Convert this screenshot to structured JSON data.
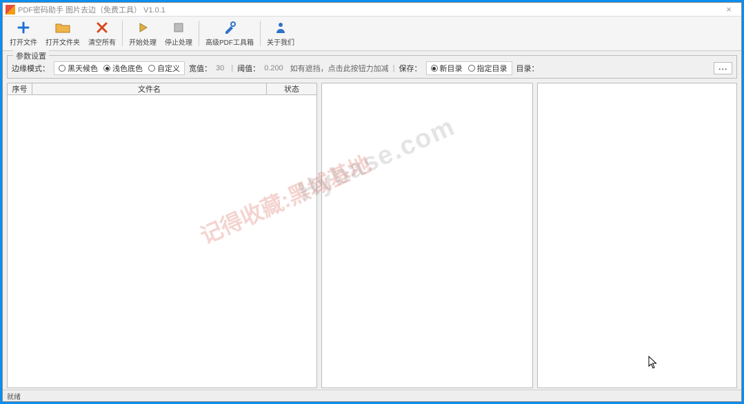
{
  "title": "PDF密码助手 图片去边（免费工具） V1.0.1",
  "toolbar": {
    "open_file": "打开文件",
    "open_files": "打开文件夹",
    "clear_all": "清空所有",
    "start": "开始处理",
    "stop": "停止处理",
    "advanced": "高级PDF工具箱",
    "about": "关于我们"
  },
  "options": {
    "legend": "参数设置",
    "edge_mode_label": "边缘模式：",
    "edge_modes": {
      "black": "黑天候色",
      "light": "浅色底色",
      "custom": "自定义"
    },
    "edge_selected": "light",
    "width_label": "宽值：",
    "width_value": "30",
    "ratio_label": "阈值：",
    "ratio_value": "0.200",
    "note": "如有遮挡，点击此按钮力加减",
    "save_label": "保存：",
    "save_modes": {
      "new": "新目录",
      "specify": "指定目录"
    },
    "save_selected": "new",
    "dir_label": "目录：",
    "dir_value": ""
  },
  "table": {
    "col_seq": "序号",
    "col_file": "文件名",
    "col_status": "状态"
  },
  "statusbar": "就绪",
  "watermark1": "记得收藏:黑域基地",
  "watermark2": "Hybase.com"
}
